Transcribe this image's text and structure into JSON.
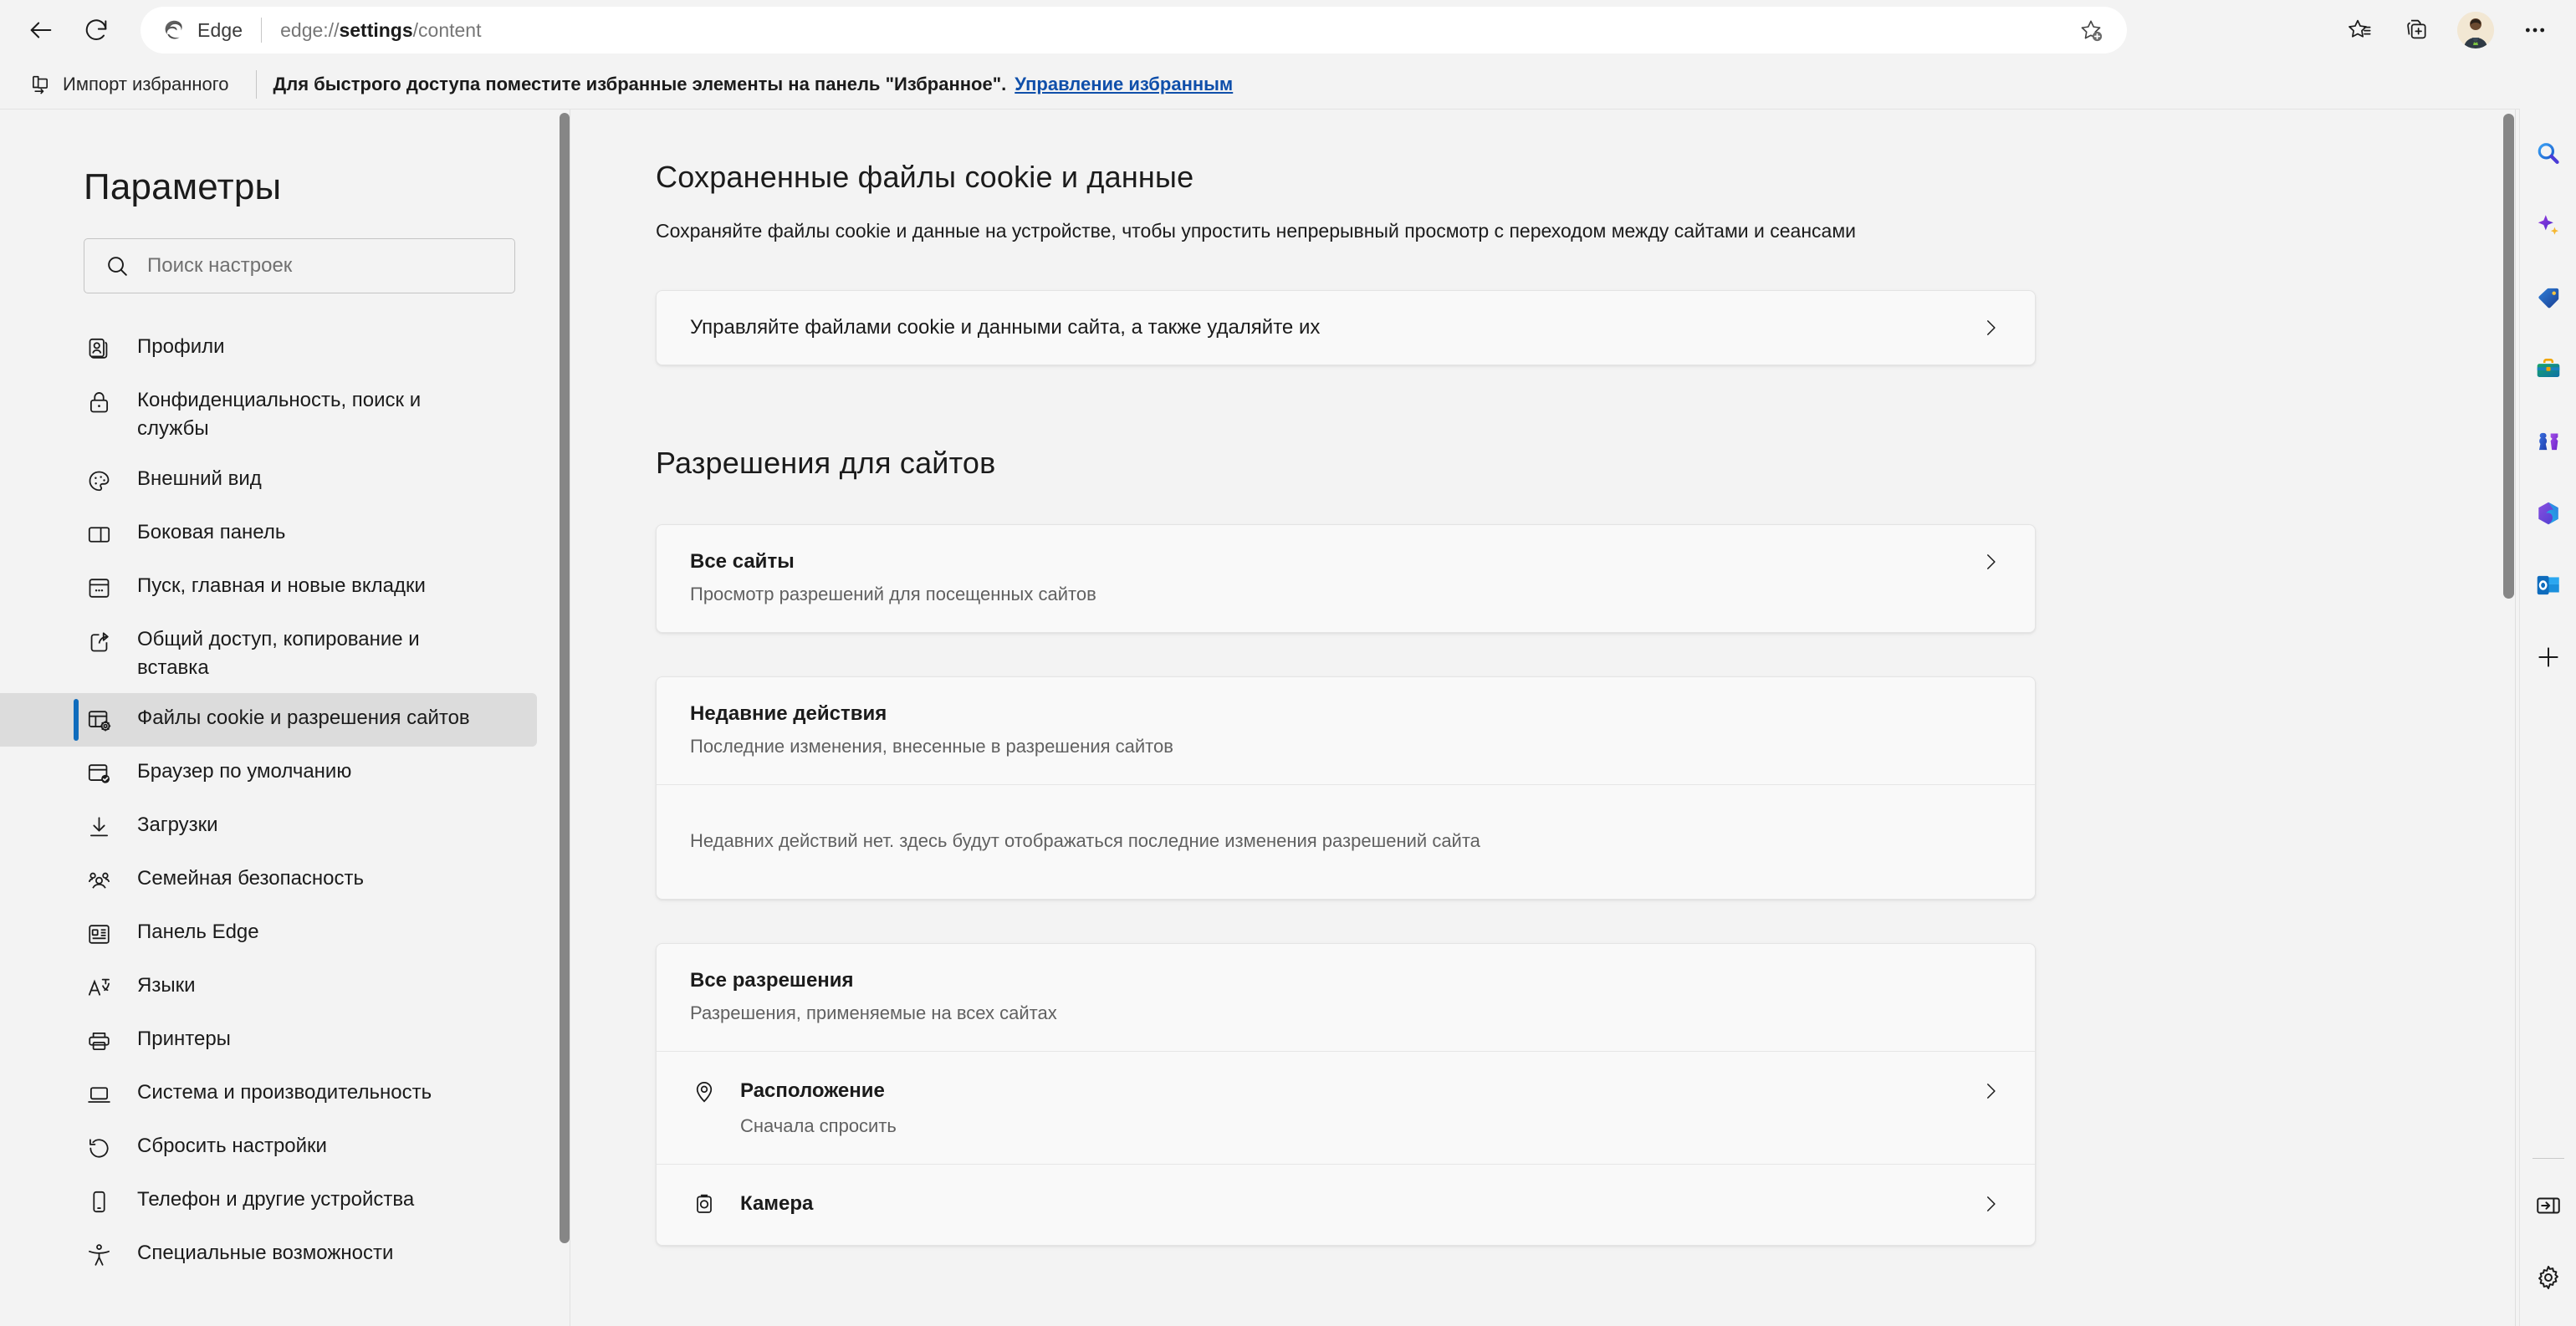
{
  "browser": {
    "back_tooltip": "Назад",
    "refresh_tooltip": "Обновить",
    "brand_label": "Edge",
    "url_prefix": "edge://",
    "url_bold": "settings",
    "url_suffix": "/content",
    "add_favorite_tooltip": "Добавить эту страницу в избранное",
    "favorites_tooltip": "Избранное",
    "collections_tooltip": "Коллекции",
    "profile_tooltip": "Профиль",
    "more_tooltip": "Параметры и другое"
  },
  "favorites_bar": {
    "import_label": "Импорт избранного",
    "note": "Для быстрого доступа поместите избранные элементы на панель \"Избранное\".",
    "manage_link": "Управление избранным"
  },
  "sidebar": {
    "title": "Параметры",
    "search_placeholder": "Поиск настроек",
    "search_value": "",
    "items": [
      {
        "label": "Профили",
        "icon": "profiles-icon",
        "selected": false
      },
      {
        "label": "Конфиденциальность, поиск и службы",
        "icon": "lock-icon",
        "selected": false
      },
      {
        "label": "Внешний вид",
        "icon": "palette-icon",
        "selected": false
      },
      {
        "label": "Боковая панель",
        "icon": "sidebar-icon",
        "selected": false
      },
      {
        "label": "Пуск, главная и новые вкладки",
        "icon": "start-page-icon",
        "selected": false
      },
      {
        "label": "Общий доступ, копирование и вставка",
        "icon": "share-icon",
        "selected": false
      },
      {
        "label": "Файлы cookie и разрешения сайтов",
        "icon": "cookie-settings-icon",
        "selected": true
      },
      {
        "label": "Браузер по умолчанию",
        "icon": "default-browser-icon",
        "selected": false
      },
      {
        "label": "Загрузки",
        "icon": "download-icon",
        "selected": false
      },
      {
        "label": "Семейная безопасность",
        "icon": "family-icon",
        "selected": false
      },
      {
        "label": "Панель Edge",
        "icon": "edge-bar-icon",
        "selected": false
      },
      {
        "label": "Языки",
        "icon": "languages-icon",
        "selected": false
      },
      {
        "label": "Принтеры",
        "icon": "printer-icon",
        "selected": false
      },
      {
        "label": "Система и производительность",
        "icon": "laptop-icon",
        "selected": false
      },
      {
        "label": "Сбросить настройки",
        "icon": "reset-icon",
        "selected": false
      },
      {
        "label": "Телефон и другие устройства",
        "icon": "phone-icon",
        "selected": false
      },
      {
        "label": "Специальные возможности",
        "icon": "accessibility-icon",
        "selected": false
      }
    ]
  },
  "content": {
    "cookies_section": {
      "title": "Сохраненные файлы cookie и данные",
      "description": "Сохраняйте файлы cookie и данные на устройстве, чтобы упростить непрерывный просмотр с переходом между сайтами и сеансами",
      "manage_row": "Управляйте файлами cookie и данными сайта, а также удаляйте их"
    },
    "permissions_section": {
      "title": "Разрешения для сайтов",
      "all_sites": {
        "title": "Все сайты",
        "subtitle": "Просмотр разрешений для посещенных сайтов"
      },
      "recent_activity": {
        "title": "Недавние действия",
        "subtitle": "Последние изменения, внесенные в разрешения сайтов",
        "empty": "Недавних действий нет. здесь будут отображаться последние изменения разрешений сайта"
      },
      "all_permissions": {
        "title": "Все разрешения",
        "subtitle": "Разрешения, применяемые на всех сайтах",
        "items": [
          {
            "label": "Расположение",
            "value": "Сначала спросить",
            "icon": "location-icon"
          },
          {
            "label": "Камера",
            "value": "",
            "icon": "camera-icon"
          }
        ]
      }
    }
  },
  "edge_sidebar": {
    "items": [
      {
        "name": "search-icon",
        "tooltip": "Поиск"
      },
      {
        "name": "copilot-icon",
        "tooltip": "Copilot"
      },
      {
        "name": "shopping-tag-icon",
        "tooltip": "Покупки"
      },
      {
        "name": "tools-icon",
        "tooltip": "Инструменты"
      },
      {
        "name": "games-icon",
        "tooltip": "Игры"
      },
      {
        "name": "office-icon",
        "tooltip": "Microsoft 365"
      },
      {
        "name": "outlook-icon",
        "tooltip": "Outlook"
      },
      {
        "name": "add-icon",
        "tooltip": "Настроить"
      }
    ],
    "bottom_items": [
      {
        "name": "toggle-sidebar-icon",
        "tooltip": "Скрыть боковую панель"
      },
      {
        "name": "gear-icon",
        "tooltip": "Параметры боковой панели"
      }
    ]
  },
  "colors": {
    "accent": "#0f6cbd",
    "link": "#0f4faa",
    "chrome_bg": "#f3f3f3",
    "card_bg": "#f9f9f9",
    "selected_bg": "#dcdcdc"
  }
}
